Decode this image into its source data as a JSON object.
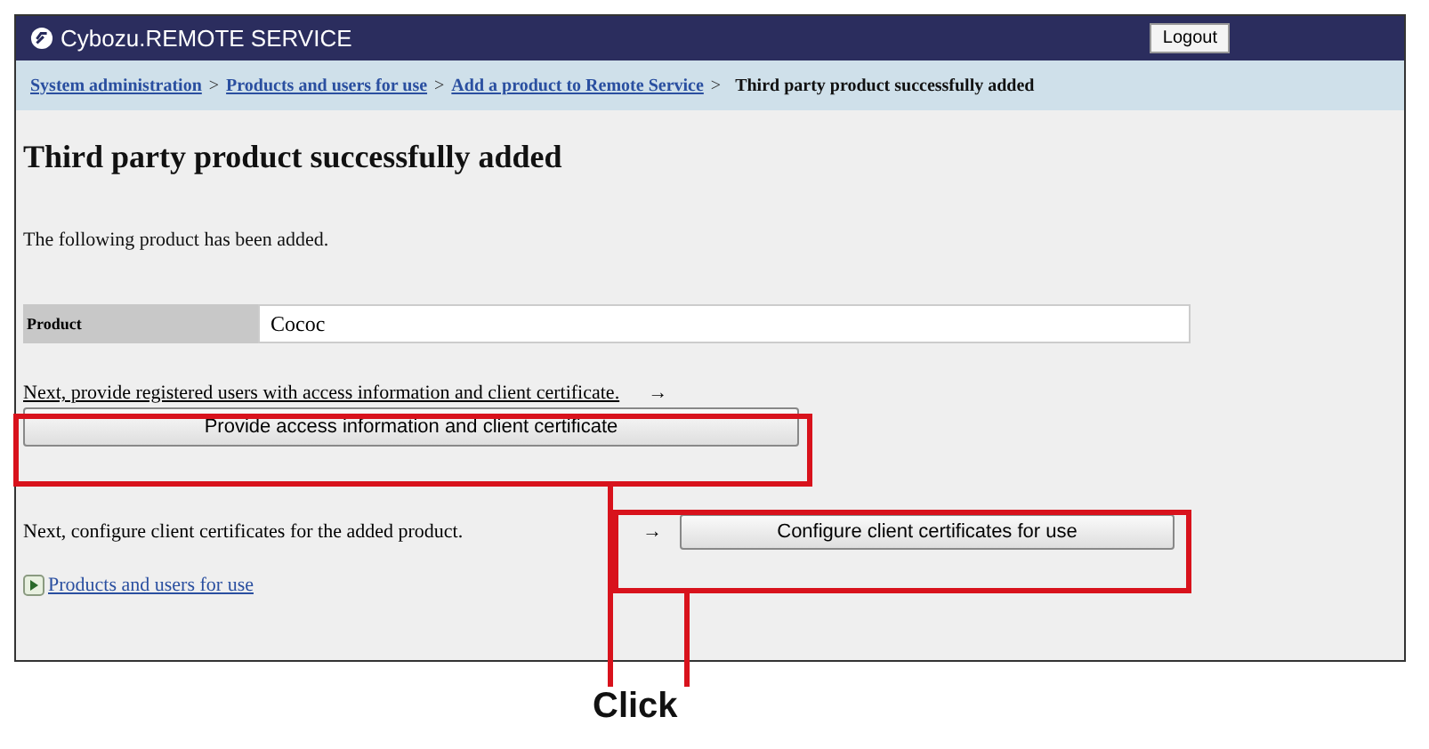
{
  "header": {
    "brand": "Cybozu.REMOTE SERVICE",
    "logout_button": "Logout"
  },
  "breadcrumb": {
    "separator": ">",
    "items": [
      {
        "label": "System administration",
        "kind": "link"
      },
      {
        "label": "Products and users for use",
        "kind": "link"
      },
      {
        "label": "Add a product to Remote Service",
        "kind": "link"
      },
      {
        "label": "Third party product successfully added",
        "kind": "current"
      }
    ]
  },
  "title": "Third party product successfully added",
  "message": "The following product has been added.",
  "product": {
    "label": "Product",
    "value": "Cococ"
  },
  "steps": [
    {
      "text": "Next, provide registered users with access information and client certificate.",
      "arrow": "→",
      "button": "Provide access information and client certificate",
      "kind": "below"
    },
    {
      "text": "Next, configure client certificates for the added product.",
      "arrow": "→",
      "button": "Configure client certificates for use",
      "kind": "inline"
    }
  ],
  "back_link": "Products and users for use",
  "annotation": "Click"
}
